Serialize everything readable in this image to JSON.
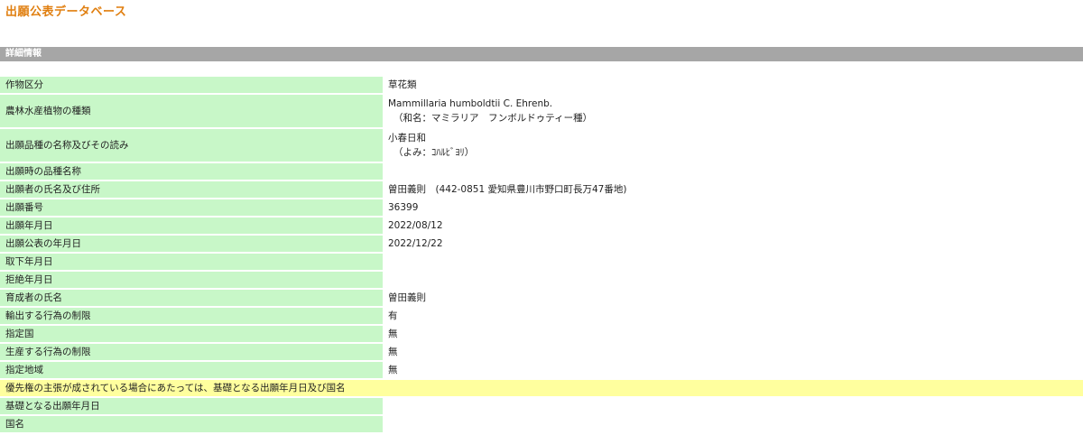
{
  "app_title": "出願公表データベース",
  "section_title": "詳細情報",
  "rows": [
    {
      "label": "作物区分",
      "value": "草花類",
      "value_sub": ""
    },
    {
      "label": "農林水産植物の種類",
      "value": "Mammillaria humboldtii C. Ehrenb.",
      "value_sub": "（和名：マミラリア　フンボルドゥティー種）"
    },
    {
      "label": "出願品種の名称及びその読み",
      "value": "小春日和",
      "value_sub": "（よみ：ｺﾊﾙﾋﾞﾖﾘ）"
    },
    {
      "label": "出願時の品種名称",
      "value": "",
      "value_sub": ""
    },
    {
      "label": "出願者の氏名及び住所",
      "value": "曽田義則　(442-0851 愛知県豊川市野口町長万47番地)",
      "value_sub": ""
    },
    {
      "label": "出願番号",
      "value": "36399",
      "value_sub": ""
    },
    {
      "label": "出願年月日",
      "value": "2022/08/12",
      "value_sub": ""
    },
    {
      "label": "出願公表の年月日",
      "value": "2022/12/22",
      "value_sub": ""
    },
    {
      "label": "取下年月日",
      "value": "",
      "value_sub": ""
    },
    {
      "label": "拒絶年月日",
      "value": "",
      "value_sub": ""
    },
    {
      "label": "育成者の氏名",
      "value": "曽田義則",
      "value_sub": ""
    },
    {
      "label": "輸出する行為の制限",
      "value": "有",
      "value_sub": ""
    },
    {
      "label": "指定国",
      "value": "無",
      "value_sub": ""
    },
    {
      "label": "生産する行為の制限",
      "value": "無",
      "value_sub": ""
    },
    {
      "label": "指定地域",
      "value": "無",
      "value_sub": ""
    }
  ],
  "priority_row": {
    "label": "優先権の主張が成されている場合にあたっては、基礎となる出願年月日及び国名"
  },
  "priority_rows": [
    {
      "label": "基礎となる出願年月日",
      "value": ""
    },
    {
      "label": "国名",
      "value": ""
    }
  ],
  "colors": {
    "title": "#e07f10",
    "section_bar": "#a6a6a6",
    "label_bg": "#c8f7c8",
    "priority_bg": "#ffff9e"
  }
}
